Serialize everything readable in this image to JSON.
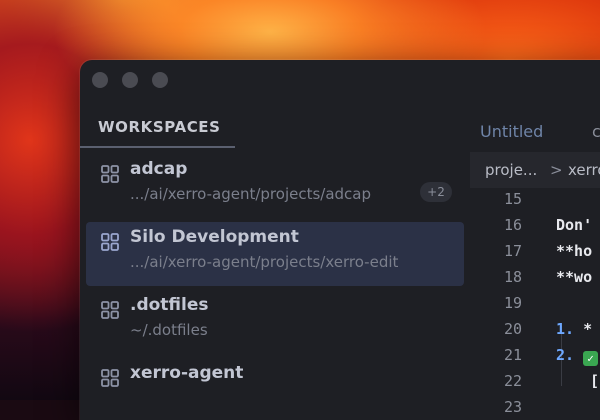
{
  "sidebar": {
    "header": "WORKSPACES",
    "items": [
      {
        "name": "adcap",
        "path": ".../ai/xerro-agent/projects/adcap",
        "badge": "+2",
        "selected": false
      },
      {
        "name": "Silo Development",
        "path": ".../ai/xerro-agent/projects/xerro-edit",
        "selected": true
      },
      {
        "name": ".dotfiles",
        "path": "~/.dotfiles",
        "selected": false
      },
      {
        "name": "xerro-agent",
        "path": "",
        "selected": false
      }
    ]
  },
  "editor": {
    "tab_label": "Untitled",
    "breadcrumb": {
      "first": "proje...",
      "separator": ">",
      "second": "xerro"
    },
    "lines": [
      {
        "n": "15",
        "text": ""
      },
      {
        "n": "16",
        "text": "Don'"
      },
      {
        "n": "17",
        "text": "**ho"
      },
      {
        "n": "18",
        "text": "**wo"
      },
      {
        "n": "19",
        "text": ""
      },
      {
        "n": "20",
        "marker": "1.",
        "text": "*"
      },
      {
        "n": "21",
        "marker": "2.",
        "text": ""
      },
      {
        "n": "22",
        "text": "["
      },
      {
        "n": "23",
        "text": ""
      }
    ]
  },
  "colors": {
    "selected_bg": "#2b3146",
    "accent_number": "#6ea8ff",
    "check_green": "#3aa651"
  },
  "icons": {
    "workspace": "grid-icon",
    "check": "check-mark-icon",
    "breadcrumb_sep": "chevron-right-icon"
  }
}
